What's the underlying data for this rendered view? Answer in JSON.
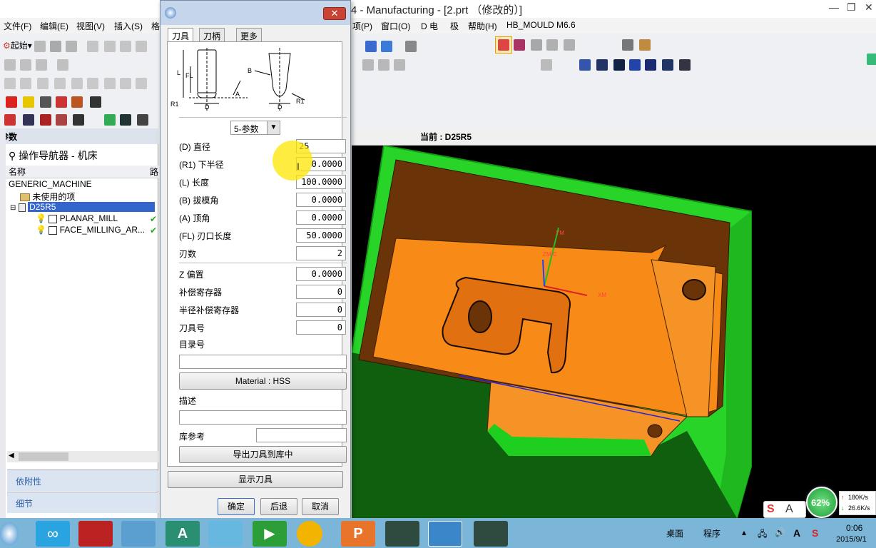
{
  "window": {
    "title": "4 - Manufacturing - [2.prt （修改的）]",
    "controls": [
      "—",
      "❐",
      "✕"
    ]
  },
  "menubar": {
    "left": [
      "文件(F)",
      "编辑(E)",
      "视图(V)",
      "插入(S)",
      "格"
    ],
    "right": [
      "项(P)",
      "窗口(O)",
      "D 电",
      "极",
      "帮助(H)",
      "HB_MOULD M6.6"
    ]
  },
  "toolbar": {
    "start_label": "起始"
  },
  "left_panel": {
    "header": "参数",
    "navigator_title": "操作导航器 - 机床",
    "columns": [
      "名称",
      "路"
    ],
    "tree": [
      "GENERIC_MACHINE",
      "未使用的项",
      "D25R5",
      "PLANAR_MILL",
      "FACE_MILLING_AR..."
    ],
    "bottom_tabs": [
      "依附性",
      "细节"
    ]
  },
  "viewport": {
    "current_label": "当前 : D25R5",
    "axis_labels": [
      "YM",
      "ZM/C",
      "XM"
    ]
  },
  "dialog": {
    "tabs": [
      "刀具",
      "刀柄",
      "更多"
    ],
    "diagram_labels": [
      "L",
      "FL",
      "R1",
      "D",
      "A",
      "B"
    ],
    "type_select": "5-参数",
    "params": [
      {
        "label": "(D) 直径",
        "value": "25"
      },
      {
        "label": "(R1) 下半径",
        "value": "0.0000"
      },
      {
        "label": "(L) 长度",
        "value": "100.0000"
      },
      {
        "label": "(B) 拔模角",
        "value": "0.0000"
      },
      {
        "label": "(A) 顶角",
        "value": "0.0000"
      },
      {
        "label": "(FL) 刃口长度",
        "value": "50.0000"
      },
      {
        "label": "刃数",
        "value": "2"
      }
    ],
    "params2": [
      {
        "label": "Z 偏置",
        "value": "0.0000"
      },
      {
        "label": "补偿寄存器",
        "value": "0"
      },
      {
        "label": "半径补偿寄存器",
        "value": "0"
      },
      {
        "label": "刀具号",
        "value": "0"
      }
    ],
    "catalog_label": "目录号",
    "material_button": "Material : HSS",
    "description_label": "描述",
    "library_label": "库参考",
    "export_button": "导出刀具到库中",
    "show_button": "显示刀具",
    "ok_button": "确定",
    "back_button": "后退",
    "cancel_button": "取消"
  },
  "taskbar": {
    "tray_left": "桌面",
    "tray_mid": "程序",
    "ime": "A",
    "time": "0:06",
    "date": "2015/9/1",
    "net_up": "180K/s",
    "net_down": "26.6K/s",
    "cpu_percent": "62%"
  }
}
